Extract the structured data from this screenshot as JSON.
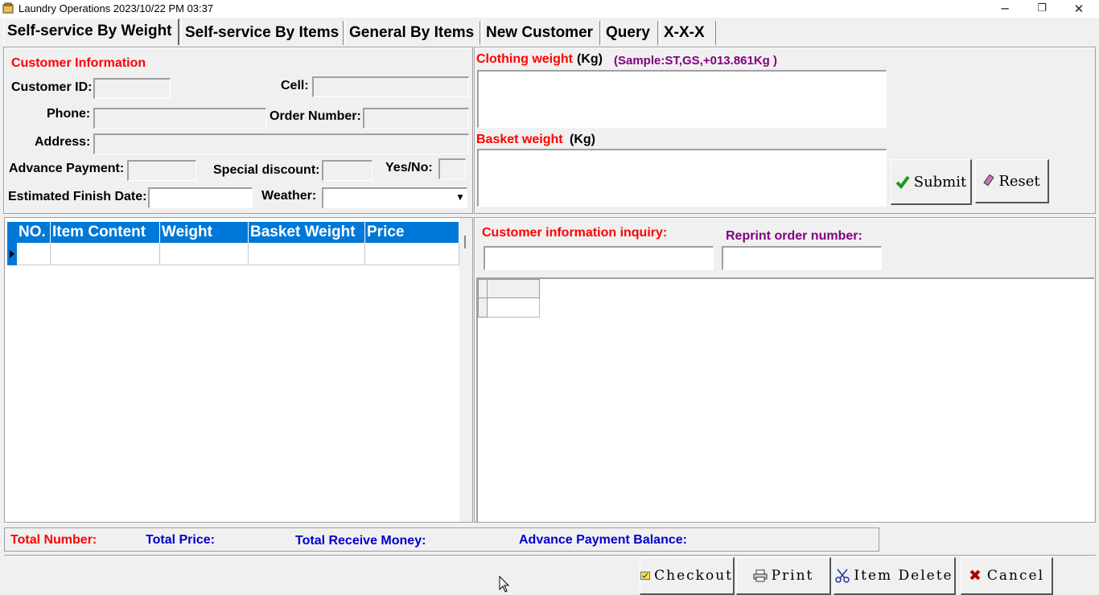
{
  "window": {
    "title": "Laundry  Operations   2023/10/22 PM 03:37",
    "minimize": "─",
    "maximize": "❐",
    "close": "✕"
  },
  "tabs": [
    {
      "label": "Self-service By Weight",
      "active": true
    },
    {
      "label": "Self-service By Items"
    },
    {
      "label": "General By Items"
    },
    {
      "label": "New Customer"
    },
    {
      "label": "Query"
    },
    {
      "label": "X-X-X"
    }
  ],
  "customer_info": {
    "heading": "Customer Information",
    "customer_id_label": "Customer ID:",
    "cell_label": "Cell:",
    "phone_label": "Phone:",
    "order_number_label": "Order Number:",
    "address_label": "Address:",
    "advance_payment_label": "Advance Payment:",
    "special_discount_label": "Special discount:",
    "yes_no_label": "Yes/No:",
    "estimated_finish_label": "Estimated Finish Date:",
    "weather_label": "Weather:",
    "customer_id": "",
    "cell": "",
    "phone": "",
    "order_number": "",
    "address": "",
    "advance_payment": "",
    "special_discount": "",
    "yes_no": "",
    "estimated_finish_date": "",
    "weather": ""
  },
  "weights": {
    "clothing_label": "Clothing weight",
    "clothing_unit": "(Kg)",
    "sample": "(Sample:ST,GS,+013.861Kg )",
    "basket_label": "Basket weight",
    "basket_unit": "(Kg)",
    "clothing_value": "",
    "basket_value": ""
  },
  "actions": {
    "submit": "Submit",
    "reset": "Reset",
    "checkout": "Checkout",
    "print": "Print",
    "item_delete": "Item Delete",
    "cancel": "Cancel"
  },
  "items_grid": {
    "columns": [
      "NO.",
      "Item Content",
      "Weight",
      "Basket Weight",
      "Price"
    ],
    "rows": [
      [
        "",
        "",
        "",
        "",
        ""
      ]
    ]
  },
  "inquiry": {
    "customer_label": "Customer information inquiry:",
    "reprint_label": "Reprint order number:",
    "customer_value": "",
    "reprint_value": ""
  },
  "totals": {
    "total_number": "Total Number:",
    "total_price": "Total Price:",
    "total_receive": "Total Receive Money:",
    "advance_balance": "Advance Payment Balance:"
  },
  "colors": {
    "accent_red": "#ff0000",
    "accent_purple": "#800080",
    "accent_blue": "#0000cc",
    "grid_header": "#0078d7"
  },
  "icons": {
    "submit": "check-icon",
    "reset": "eraser-icon",
    "checkout": "checklist-icon",
    "print": "printer-icon",
    "item_delete": "scissors-icon",
    "cancel": "x-icon"
  }
}
